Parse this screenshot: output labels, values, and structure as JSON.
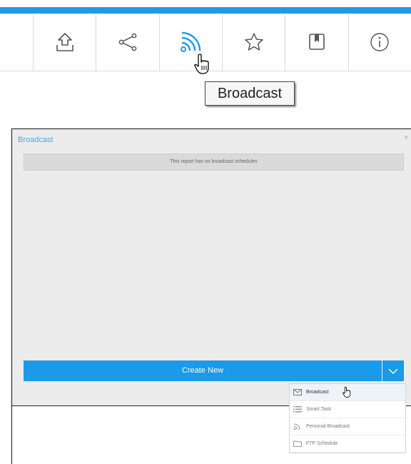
{
  "toolbar": {
    "accent_color": "#1f9ae6",
    "buttons": [
      {
        "name": "export",
        "icon": "upload-icon",
        "active": false
      },
      {
        "name": "share",
        "icon": "share-icon",
        "active": false
      },
      {
        "name": "broadcast",
        "icon": "rss-icon",
        "active": true
      },
      {
        "name": "favourite",
        "icon": "star-icon",
        "active": false
      },
      {
        "name": "bookmark",
        "icon": "bookmark-icon",
        "active": false
      },
      {
        "name": "info",
        "icon": "info-icon",
        "active": false
      }
    ],
    "tooltip": "Broadcast"
  },
  "modal": {
    "title": "Broadcast",
    "close_label": "×",
    "empty_message": "This report has no broadcast schedules",
    "create_button_label": "Create New",
    "dropdown_icon": "chevron-down-icon"
  },
  "dropdown": {
    "items": [
      {
        "label": "Broadcast",
        "icon": "envelope-icon",
        "hovered": true
      },
      {
        "label": "Smart Task",
        "icon": "list-icon",
        "hovered": false
      },
      {
        "label": "Personal Broadcast",
        "icon": "rss-icon",
        "hovered": false
      },
      {
        "label": "FTP Schedule",
        "icon": "folder-icon",
        "hovered": false
      }
    ]
  },
  "colors": {
    "primary": "#1a9ae8",
    "panel_bg": "#ececec",
    "title": "#4aa6e6"
  }
}
